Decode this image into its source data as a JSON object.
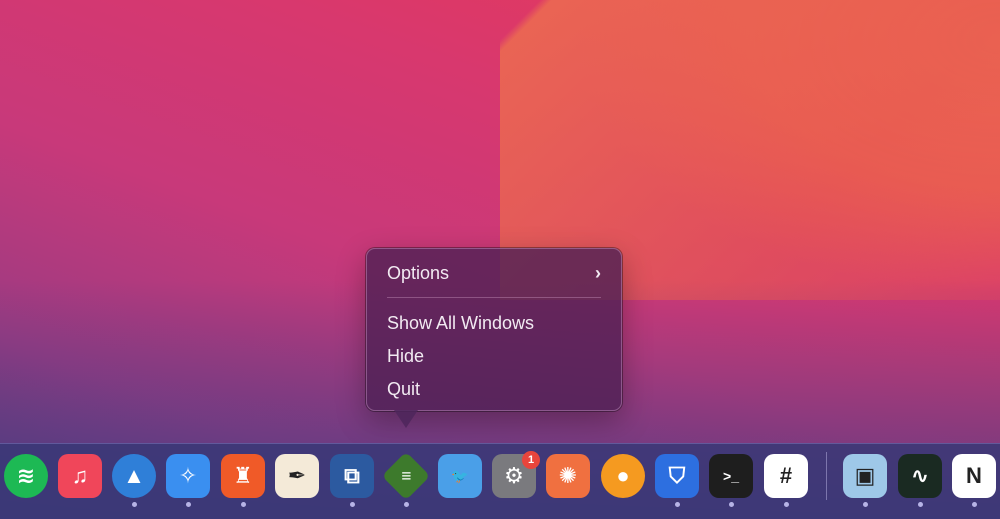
{
  "context_menu": {
    "items": [
      {
        "label": "Options",
        "has_submenu": true,
        "submenu_glyph": "›"
      },
      {
        "label": "Show All Windows"
      },
      {
        "label": "Hide"
      },
      {
        "label": "Quit"
      }
    ]
  },
  "dock": {
    "apps": [
      {
        "name": "Spotify",
        "icon": "spotify-icon",
        "running": false,
        "glyph": "≋",
        "color": "#1db954"
      },
      {
        "name": "Music",
        "icon": "music-icon",
        "running": false,
        "glyph": "♫",
        "color": "#f0465a"
      },
      {
        "name": "Spark",
        "icon": "spark-mail-icon",
        "running": true,
        "glyph": "▲",
        "color": "#2f7fd8"
      },
      {
        "name": "Safari",
        "icon": "safari-icon",
        "running": true,
        "glyph": "✧",
        "color": "#3a8ff0"
      },
      {
        "name": "Brave",
        "icon": "brave-lion-icon",
        "running": true,
        "glyph": "♜",
        "color": "#f05a28"
      },
      {
        "name": "Pages-like Writer",
        "icon": "quill-pen-icon",
        "running": false,
        "glyph": "✒",
        "color": "#f4ead8"
      },
      {
        "name": "Screen Resize",
        "icon": "resize-icon",
        "running": true,
        "glyph": "⧉",
        "color": "#2c5aa0"
      },
      {
        "name": "Feedly",
        "icon": "feedly-icon",
        "running": true,
        "glyph": "≡",
        "color": "#3d7a2c"
      },
      {
        "name": "Twitter",
        "icon": "twitter-bird-icon",
        "running": false,
        "glyph": "🐦",
        "color": "#4a9fe8"
      },
      {
        "name": "System Preferences",
        "icon": "gear-icon",
        "running": false,
        "glyph": "⚙",
        "color": "#7a7a7e",
        "badge": "1"
      },
      {
        "name": "Mandala",
        "icon": "mandala-picture-icon",
        "running": false,
        "glyph": "✺",
        "color": "#f07040"
      },
      {
        "name": "Squash",
        "icon": "orange-icon",
        "running": false,
        "glyph": "●",
        "color": "#f59a20"
      },
      {
        "name": "Bitwarden",
        "icon": "shield-icon",
        "running": true,
        "glyph": "⛉",
        "color": "#2d6fe0"
      },
      {
        "name": "Terminal",
        "icon": "terminal-icon",
        "running": true,
        "glyph": ">_",
        "color": "#1e1e1e"
      },
      {
        "name": "Slack",
        "icon": "slack-icon",
        "running": true,
        "glyph": "#",
        "color": "#ffffff"
      },
      {
        "name": "Preview",
        "icon": "preview-icon",
        "running": true,
        "glyph": "▣",
        "color": "#9ec8e8"
      },
      {
        "name": "Activity Monitor",
        "icon": "activity-monitor-icon",
        "running": true,
        "glyph": "∿",
        "color": "#1a2a22"
      },
      {
        "name": "Notion",
        "icon": "notion-icon",
        "running": true,
        "glyph": "N",
        "color": "#ffffff"
      }
    ]
  }
}
